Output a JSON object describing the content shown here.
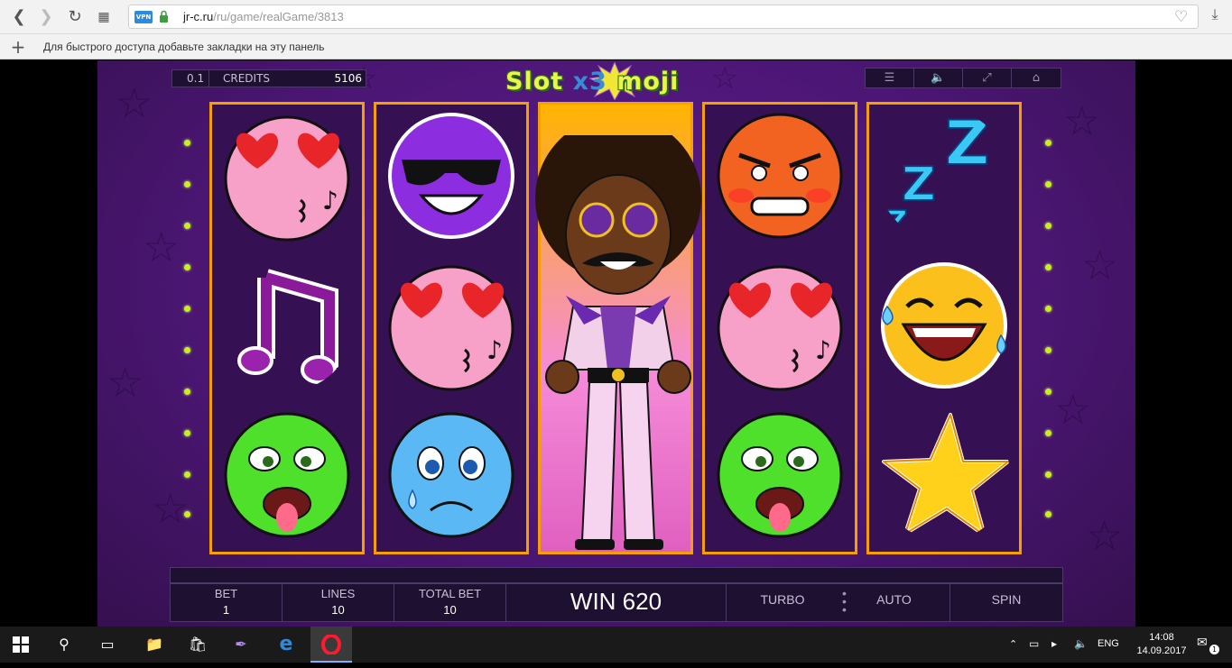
{
  "browser": {
    "url_host": "jr-c.ru",
    "url_path": "/ru/game/realGame/3813",
    "vpn_label": "VPN",
    "bookmark_hint": "Для быстрого доступа добавьте закладки на эту панель"
  },
  "game": {
    "logo_left": "Slot",
    "logo_x": "x",
    "logo_3": "3",
    "logo_right": "moji",
    "bet_per_line": "0.1",
    "credits_label": "CREDITS",
    "credits_value": "5106",
    "reels": [
      [
        "heart-eyes-kiss",
        "music-note",
        "nauseated"
      ],
      [
        "sunglasses",
        "heart-eyes-kiss",
        "sad-tear"
      ],
      [
        "afro-dancer-wild"
      ],
      [
        "angry",
        "heart-eyes-kiss",
        "nauseated"
      ],
      [
        "sleeping-zzz",
        "laughing-tears",
        "star"
      ]
    ],
    "bottom_bar": {
      "bet_label": "BET",
      "bet_value": "1",
      "lines_label": "LINES",
      "lines_value": "10",
      "total_bet_label": "TOTAL BET",
      "total_bet_value": "10",
      "win_text": "WIN 620",
      "turbo_label": "TURBO",
      "auto_label": "AUTO",
      "spin_label": "SPIN"
    }
  },
  "taskbar": {
    "language": "ENG",
    "time": "14:08",
    "date": "14.09.2017",
    "notification_count": "1"
  },
  "colors": {
    "reel_border": "#f5a000",
    "game_bg": "#4a1573",
    "payline_dot": "#c7f01f"
  }
}
